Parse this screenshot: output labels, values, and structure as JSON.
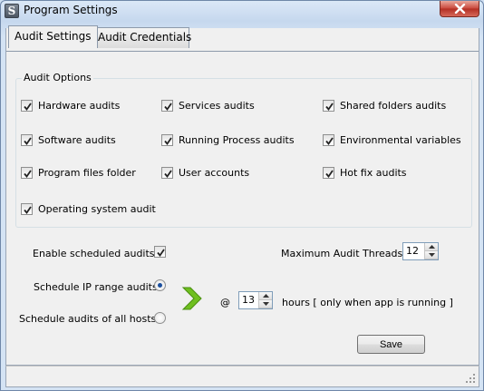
{
  "window": {
    "title": "Program Settings",
    "app_icon_letter": "S"
  },
  "tabs": [
    {
      "label": "Audit Settings",
      "active": true
    },
    {
      "label": "Audit Credentials",
      "active": false
    }
  ],
  "audit_options": {
    "legend": "Audit Options",
    "items": [
      {
        "label": "Hardware audits",
        "checked": true
      },
      {
        "label": "Services audits",
        "checked": true
      },
      {
        "label": "Shared folders audits",
        "checked": true
      },
      {
        "label": "Software audits",
        "checked": true
      },
      {
        "label": "Running Process audits",
        "checked": true
      },
      {
        "label": "Environmental variables",
        "checked": true
      },
      {
        "label": "Program files folder",
        "checked": true
      },
      {
        "label": "User accounts",
        "checked": true
      },
      {
        "label": "Hot fix audits",
        "checked": true
      },
      {
        "label": "Operating system audit",
        "checked": true
      }
    ]
  },
  "schedule": {
    "enable_label": "Enable scheduled audits",
    "enable_checked": true,
    "max_threads_label": "Maximum Audit Threads",
    "max_threads_value": "12",
    "ip_range_label": "Schedule IP range audits",
    "ip_range_selected": true,
    "all_hosts_label": "Schedule audits of all hosts",
    "all_hosts_selected": false,
    "at_symbol": "@",
    "hours_value": "13",
    "hours_label": "hours [ only when app is running ]"
  },
  "buttons": {
    "save_label": "Save"
  },
  "colors": {
    "accent_arrow": "#6fbf1f",
    "radio_dot": "#1b4f9e",
    "close_red": "#c9463a"
  }
}
